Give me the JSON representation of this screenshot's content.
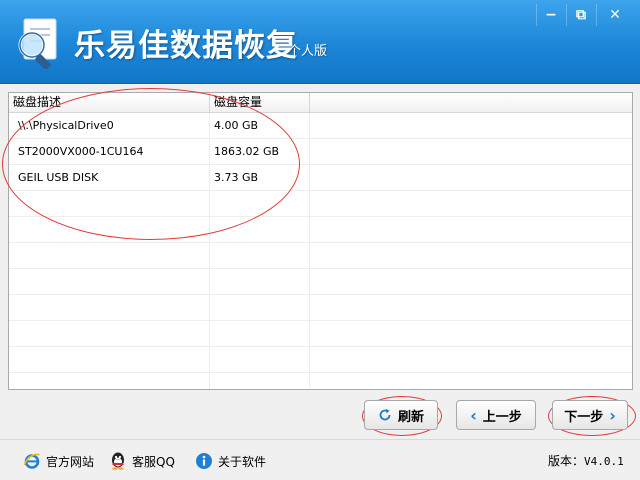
{
  "app": {
    "title": "乐易佳数据恢复",
    "edition": "个人版"
  },
  "window_controls": {
    "minimize_glyph": "−",
    "maximize_glyph": "⧉",
    "close_glyph": "✕"
  },
  "table": {
    "columns": [
      "磁盘描述",
      "磁盘容量"
    ],
    "rows": [
      {
        "description": "\\\\.\\PhysicalDrive0",
        "capacity": "4.00 GB"
      },
      {
        "description": "ST2000VX000-1CU164",
        "capacity": "1863.02 GB"
      },
      {
        "description": "GEIL USB DISK",
        "capacity": "3.73 GB"
      }
    ]
  },
  "buttons": {
    "refresh": "刷新",
    "prev": "上一步",
    "next": "下一步"
  },
  "footer": {
    "website": "官方网站",
    "qq": "客服QQ",
    "about": "关于软件",
    "version_label": "版本：",
    "version_value": "V4.0.1"
  },
  "icons": {
    "logo": "magnifier-document-icon",
    "refresh": "refresh-icon",
    "prev": "chevron-left-icon",
    "next": "chevron-right-icon",
    "website": "ie-browser-icon",
    "qq": "qq-penguin-icon",
    "about": "info-icon"
  },
  "colors": {
    "titlebar": "#1c86d8",
    "annotation": "#e23b3b",
    "accent": "#1a79c9"
  }
}
